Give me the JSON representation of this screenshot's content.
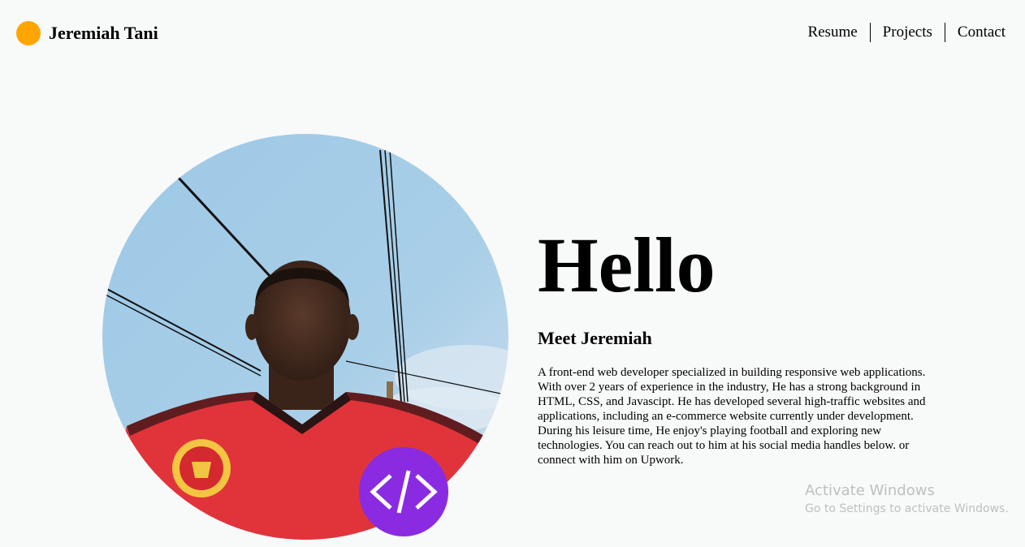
{
  "header": {
    "brand_name": "Jeremiah Tani",
    "nav": [
      {
        "label": "Resume"
      },
      {
        "label": "Projects"
      },
      {
        "label": "Contact"
      }
    ]
  },
  "hero": {
    "heading": "Hello",
    "subheading": "Meet Jeremiah",
    "bio": "A front-end web developer specialized in building responsive web applications. With over 2 years of experience in the industry, He has a strong background in HTML, CSS, and Javascipt. He has developed several high-traffic websites and applications, including an e-commerce website currently under development. During his leisure time, He enjoy's playing football and exploring new technologies. You can reach out to him at his social media handles below. or connect with him on Upwork.",
    "badge_icon": "code-brackets-icon"
  },
  "watermark": {
    "title": "Activate Windows",
    "subtitle": "Go to Settings to activate Windows."
  },
  "colors": {
    "brand_dot": "#ffa500",
    "badge": "#8a2be2",
    "background": "#f8f9f9",
    "jersey": "#e0343a"
  }
}
